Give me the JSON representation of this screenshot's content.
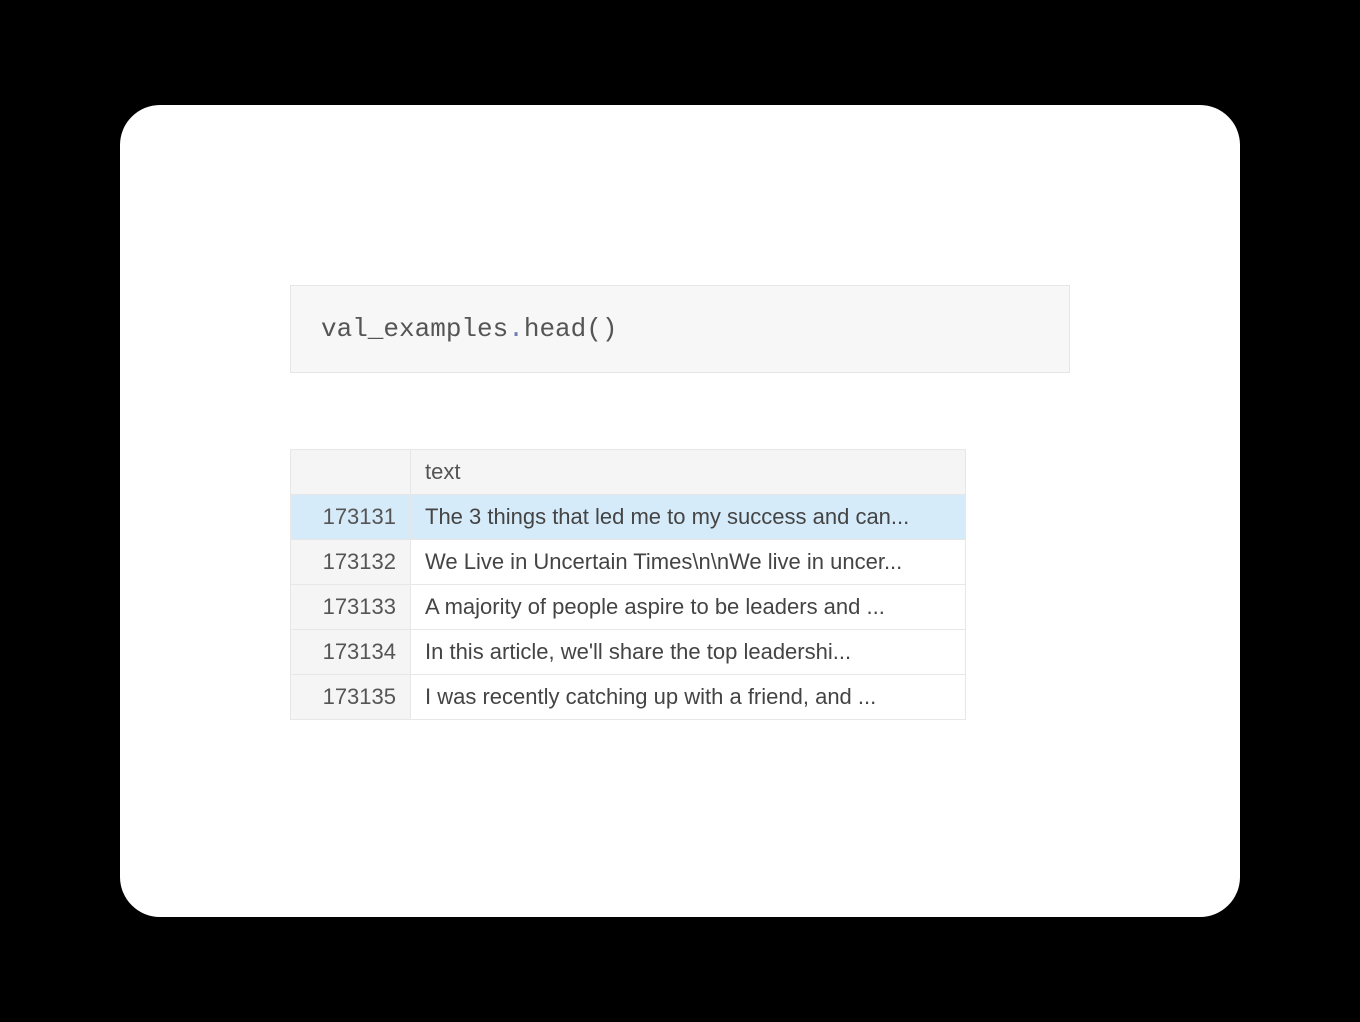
{
  "code": {
    "var_name": "val_examples",
    "dot": ".",
    "method": "head()"
  },
  "table": {
    "columns": [
      "text"
    ],
    "index_header": "",
    "rows": [
      {
        "index": "173131",
        "text": "The 3 things that led me to my success and can...",
        "highlight": true
      },
      {
        "index": "173132",
        "text": "We Live in Uncertain Times\\n\\nWe live in uncer...",
        "highlight": false
      },
      {
        "index": "173133",
        "text": "A majority of people aspire to be leaders and ...",
        "highlight": false
      },
      {
        "index": "173134",
        "text": "In this article, we'll share the top leadershi...",
        "highlight": false
      },
      {
        "index": "173135",
        "text": "I was recently catching up with a friend, and ...",
        "highlight": false
      }
    ]
  }
}
